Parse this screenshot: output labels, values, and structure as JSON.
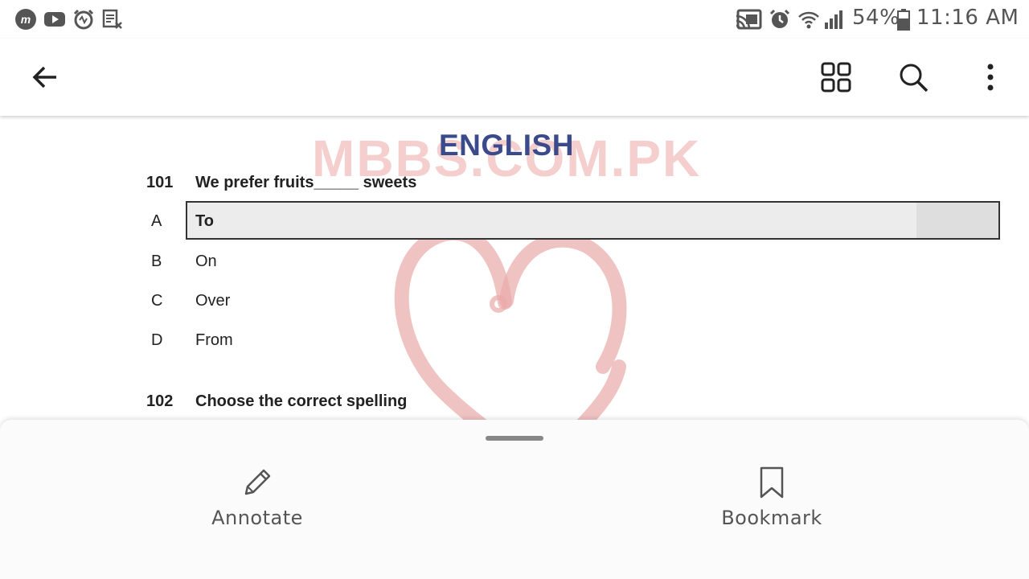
{
  "status_bar": {
    "left_icons": [
      "mi-app-icon",
      "youtube-icon",
      "alarm-app-icon",
      "note-icon"
    ],
    "right_icons": [
      "cast-icon",
      "alarm-icon",
      "wifi-icon",
      "signal-icon",
      "battery-icon"
    ],
    "battery": "54%",
    "time": "11:16 AM"
  },
  "toolbar": {
    "back_icon": "arrow-left-icon",
    "grid_icon": "grid-view-icon",
    "search_icon": "search-icon",
    "menu_icon": "more-vertical-icon"
  },
  "document": {
    "watermark": "MBBS.COM.PK",
    "subject": "ENGLISH",
    "questions": [
      {
        "number": "101",
        "text": "We prefer fruits_____ sweets",
        "options": [
          {
            "letter": "A",
            "text": "To",
            "selected": true
          },
          {
            "letter": "B",
            "text": "On"
          },
          {
            "letter": "C",
            "text": "Over"
          },
          {
            "letter": "D",
            "text": "From"
          }
        ]
      },
      {
        "number": "102",
        "text": "Choose the correct spelling"
      }
    ]
  },
  "bottom_sheet": {
    "annotate_label": "Annotate",
    "annotate_icon": "pencil-icon",
    "bookmark_label": "Bookmark",
    "bookmark_icon": "bookmark-icon"
  },
  "colors": {
    "subject_text": "#3b4a8a",
    "watermark": "#f4c6c6",
    "heart": "#e9a9a9"
  }
}
